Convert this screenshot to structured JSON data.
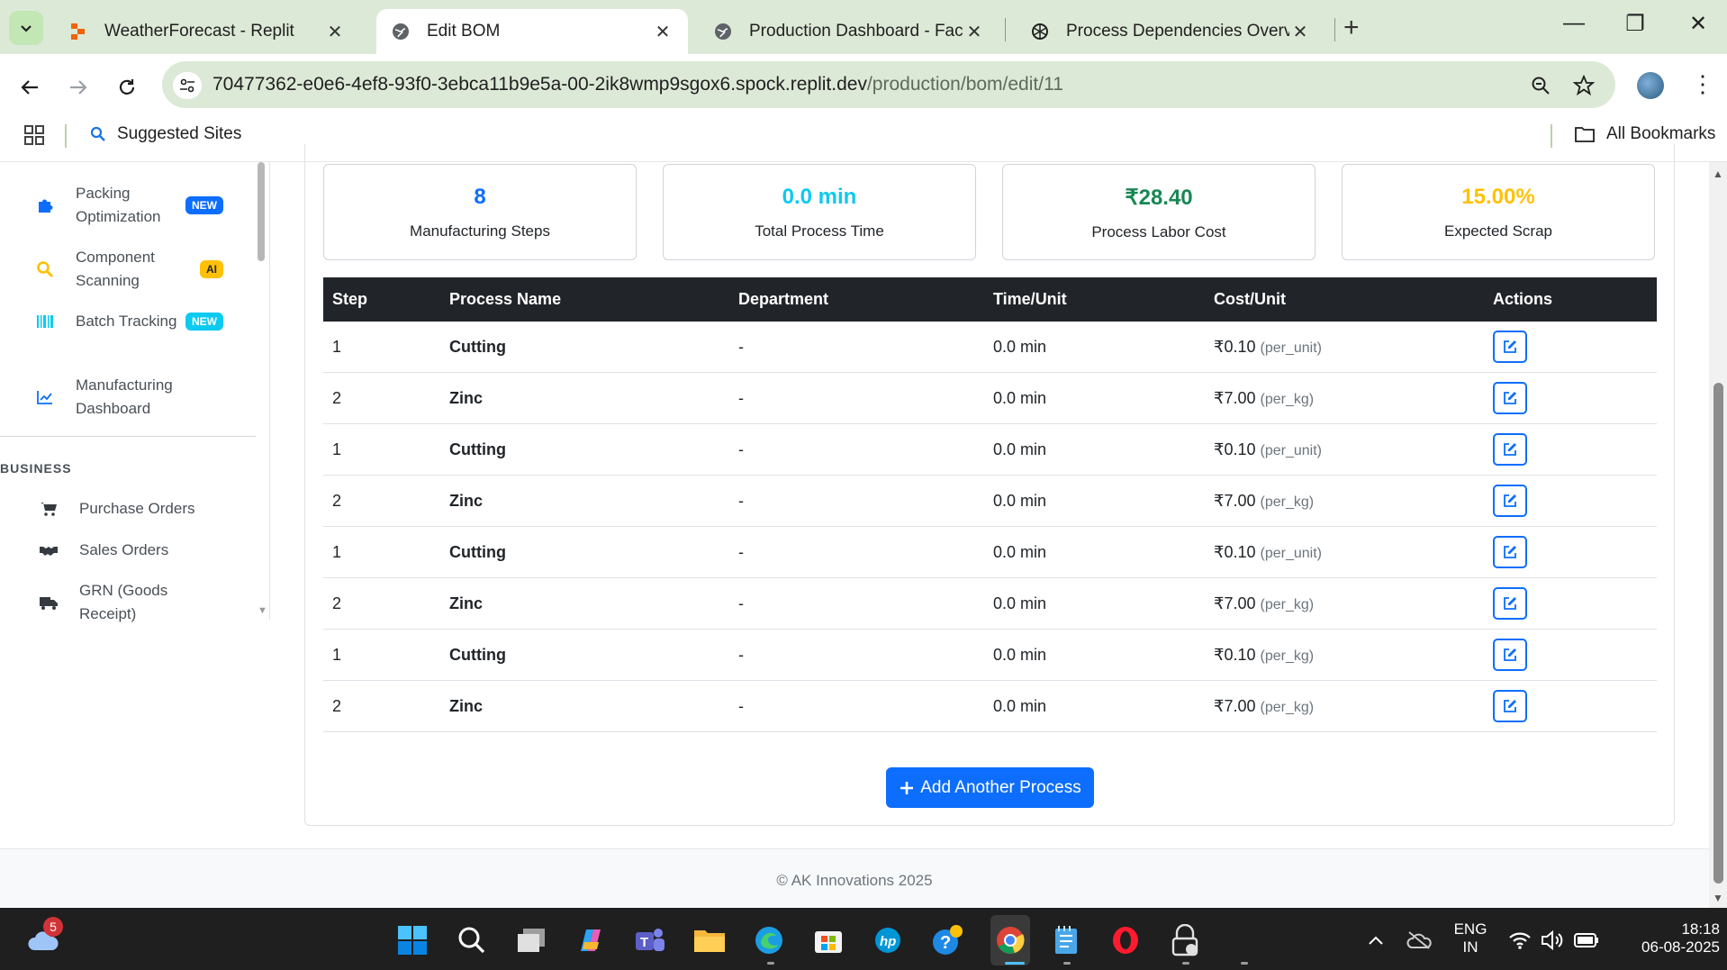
{
  "browser": {
    "tabs": [
      {
        "title": "WeatherForecast - Replit",
        "active": false
      },
      {
        "title": "Edit BOM",
        "active": true
      },
      {
        "title": "Production Dashboard - Factory",
        "active": false
      },
      {
        "title": "Process Dependencies Overview",
        "active": false
      }
    ],
    "url_host": "70477362-e0e6-4ef8-93f0-3ebca11b9e5a-00-2ik8wmp9sgox6.spock.replit.dev",
    "url_path": "/production/bom/edit/11",
    "bookmarks": {
      "suggested": "Suggested Sites",
      "all": "All Bookmarks"
    }
  },
  "sidebar": {
    "items": [
      {
        "label": "Packing Optimization",
        "badge": "NEW",
        "icon": "puzzle-icon"
      },
      {
        "label": "Component Scanning",
        "badge": "AI",
        "icon": "search-icon"
      },
      {
        "label": "Batch Tracking",
        "badge": "NEW",
        "icon": "barcode-icon"
      },
      {
        "label": "Manufacturing Dashboard",
        "badge": "",
        "icon": "chart-line-icon"
      }
    ],
    "section": "BUSINESS",
    "business_items": [
      {
        "label": "Purchase Orders",
        "icon": "cart-icon"
      },
      {
        "label": "Sales Orders",
        "icon": "handshake-icon"
      },
      {
        "label": "GRN (Goods Receipt)",
        "icon": "truck-icon"
      }
    ]
  },
  "stats": [
    {
      "value": "8",
      "label": "Manufacturing Steps",
      "color": "#0d6efd"
    },
    {
      "value": "0.0 min",
      "label": "Total Process Time",
      "color": "#0dcaf0"
    },
    {
      "value": "₹28.40",
      "label": "Process Labor Cost",
      "color": "#198754"
    },
    {
      "value": "15.00%",
      "label": "Expected Scrap",
      "color": "#ffc107"
    }
  ],
  "table": {
    "headers": [
      "Step",
      "Process Name",
      "Department",
      "Time/Unit",
      "Cost/Unit",
      "Actions"
    ],
    "rows": [
      {
        "step": "1",
        "process": "Cutting",
        "dept": "-",
        "time": "0.0 min",
        "cost": "₹0.10",
        "unit": "(per_unit)"
      },
      {
        "step": "2",
        "process": "Zinc",
        "dept": "-",
        "time": "0.0 min",
        "cost": "₹7.00",
        "unit": "(per_kg)"
      },
      {
        "step": "1",
        "process": "Cutting",
        "dept": "-",
        "time": "0.0 min",
        "cost": "₹0.10",
        "unit": "(per_unit)"
      },
      {
        "step": "2",
        "process": "Zinc",
        "dept": "-",
        "time": "0.0 min",
        "cost": "₹7.00",
        "unit": "(per_kg)"
      },
      {
        "step": "1",
        "process": "Cutting",
        "dept": "-",
        "time": "0.0 min",
        "cost": "₹0.10",
        "unit": "(per_unit)"
      },
      {
        "step": "2",
        "process": "Zinc",
        "dept": "-",
        "time": "0.0 min",
        "cost": "₹7.00",
        "unit": "(per_kg)"
      },
      {
        "step": "1",
        "process": "Cutting",
        "dept": "-",
        "time": "0.0 min",
        "cost": "₹0.10",
        "unit": "(per_kg)"
      },
      {
        "step": "2",
        "process": "Zinc",
        "dept": "-",
        "time": "0.0 min",
        "cost": "₹7.00",
        "unit": "(per_kg)"
      }
    ]
  },
  "add_button": "Add Another Process",
  "footer": "© AK Innovations 2025",
  "taskbar": {
    "weather_badge": "5",
    "lang_top": "ENG",
    "lang_bottom": "IN",
    "time": "18:18",
    "date": "06-08-2025"
  }
}
